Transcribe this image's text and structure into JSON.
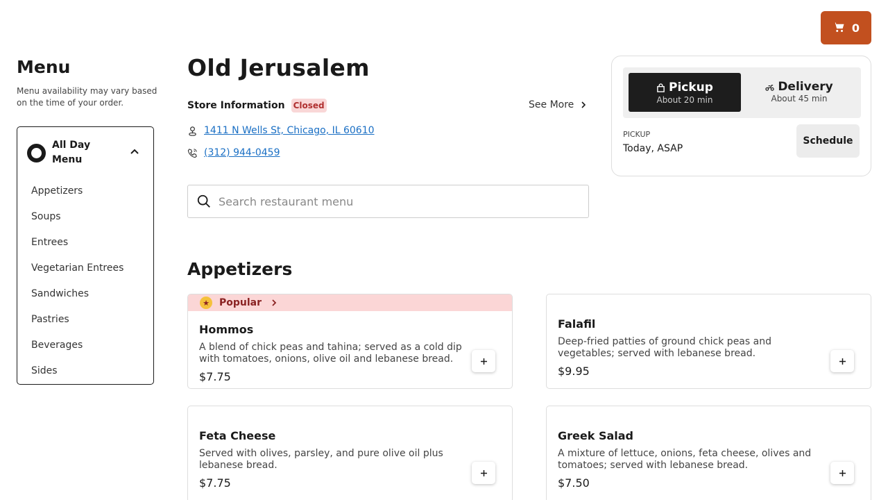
{
  "cart": {
    "count": "0",
    "icon": "cart-icon"
  },
  "sidebar": {
    "title": "Menu",
    "note": "Menu availability may vary based on the time of your order.",
    "menu_group": "All Day Menu",
    "items": [
      {
        "label": "Appetizers"
      },
      {
        "label": "Soups"
      },
      {
        "label": "Entrees"
      },
      {
        "label": "Vegetarian Entrees"
      },
      {
        "label": "Sandwiches"
      },
      {
        "label": "Pastries"
      },
      {
        "label": "Beverages"
      },
      {
        "label": "Sides"
      }
    ]
  },
  "store": {
    "name": "Old Jerusalem",
    "info_title": "Store Information",
    "status": "Closed",
    "see_more": "See More",
    "address": "1411 N Wells St, Chicago, IL 60610",
    "phone": "(312) 944-0459"
  },
  "search": {
    "placeholder": "Search restaurant menu"
  },
  "order": {
    "pickup": {
      "label": "Pickup",
      "sub": "About 20 min"
    },
    "delivery": {
      "label": "Delivery",
      "sub": "About 45 min"
    },
    "mode_label": "PICKUP",
    "time": "Today, ASAP",
    "schedule": "Schedule"
  },
  "section": {
    "title": "Appetizers",
    "popular_label": "Popular",
    "items": [
      {
        "name": "Hommos",
        "desc": "A blend of chick peas and tahina; served as a cold dip with tomatoes, onions, olive oil and lebanese bread.",
        "price": "$7.75"
      },
      {
        "name": "Falafil",
        "desc": "Deep-fried patties of ground chick peas and vegetables; served with lebanese bread.",
        "price": "$9.95"
      },
      {
        "name": "Feta Cheese",
        "desc": "Served with olives, parsley, and pure olive oil plus lebanese bread.",
        "price": "$7.75"
      },
      {
        "name": "Greek Salad",
        "desc": "A mixture of lettuce, onions, feta cheese, olives and tomatoes; served with lebanese bread.",
        "price": "$7.50"
      }
    ]
  },
  "colors": {
    "accent": "#c2501f",
    "popular_bg": "#fbd6d6",
    "link": "#1a6fc4"
  }
}
